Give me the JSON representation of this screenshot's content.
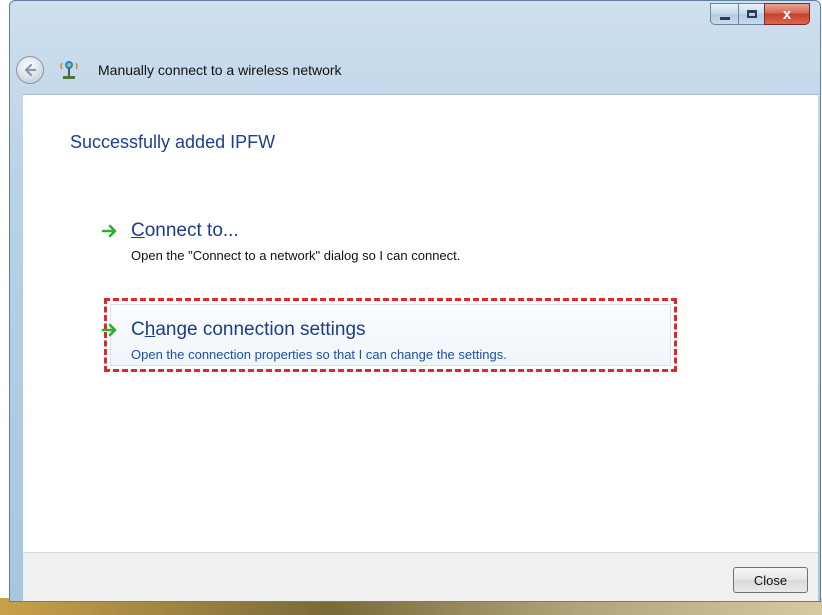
{
  "window": {
    "title": "Manually connect to a wireless network",
    "controls": {
      "minimize_icon": "minimize-icon",
      "maximize_icon": "maximize-icon",
      "close_icon": "close-icon",
      "close_glyph": "x"
    }
  },
  "nav": {
    "back_icon": "back-arrow-icon",
    "network_icon": "wireless-network-icon"
  },
  "content": {
    "heading": "Successfully added IPFW",
    "options": [
      {
        "icon": "green-arrow-icon",
        "title_mnemonic": "C",
        "title_rest": "onnect to...",
        "description": "Open the \"Connect to a network\" dialog so I can connect."
      },
      {
        "icon": "green-arrow-icon",
        "title_prefix": "C",
        "title_mnemonic": "h",
        "title_rest": "ange connection settings",
        "description": "Open the connection properties so that I can change the settings.",
        "highlighted": true
      }
    ]
  },
  "footer": {
    "close_label": "Close"
  },
  "colors": {
    "accent_link": "#1b3d86",
    "highlight_dash": "#e3262a",
    "arrow_green": "#2bb02b"
  }
}
